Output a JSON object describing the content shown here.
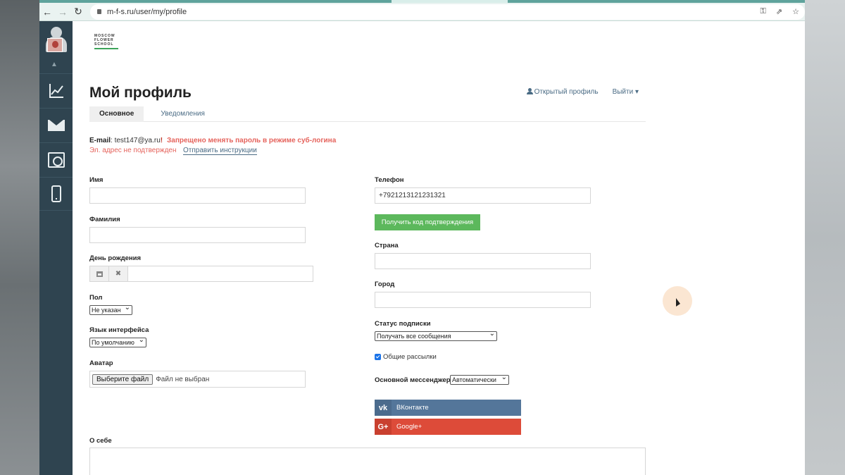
{
  "browser": {
    "url": "m-f-s.ru/user/my/profile"
  },
  "logo": {
    "line1": "MOSCOW",
    "line2": "FLOWER",
    "line3": "SCHOOL"
  },
  "page": {
    "title": "Мой профиль",
    "open_profile_link": "Открытый профиль",
    "logout_link": "Выйти ▾"
  },
  "tabs": [
    {
      "label": "Основное",
      "active": true
    },
    {
      "label": "Уведомления",
      "active": false
    }
  ],
  "email": {
    "label": "E-mail",
    "value": ": test147@ya.ru",
    "alert_mark": "!",
    "warning": "Запрещено менять пароль в режиме суб-логина",
    "unverified": "Эл. адрес не подтвержден",
    "send_instructions": "Отправить инструкции"
  },
  "form_left": {
    "name_label": "Имя",
    "name_value": "",
    "surname_label": "Фамилия",
    "surname_value": "",
    "birthday_label": "День рождения",
    "birthday_value": "",
    "gender_label": "Пол",
    "gender_value": "Не указан",
    "language_label": "Язык интерфейса",
    "language_value": "По умолчанию",
    "avatar_label": "Аватар",
    "avatar_button": "Выберите файл",
    "avatar_status": "Файл не выбран",
    "about_label": "О себе"
  },
  "form_right": {
    "phone_label": "Телефон",
    "phone_value": "+7921213121231321",
    "get_code_button": "Получить код подтверждения",
    "country_label": "Страна",
    "country_value": "",
    "city_label": "Город",
    "city_value": "",
    "subscription_label": "Статус подписки",
    "subscription_value": "Получать все сообщения",
    "newsletters_label": "Общие рассылки",
    "newsletters_checked": true,
    "messenger_label": "Основной мессенджер",
    "messenger_value": "Автоматически",
    "vk_button": "ВКонтакте",
    "vk_icon_text": "vk",
    "google_button": "Google+",
    "google_icon_text": "G+"
  },
  "colors": {
    "sidebar": "#2f4450",
    "link": "#4a6b84",
    "error": "#e5635c",
    "green_button": "#5cb85c",
    "vk": "#54769a",
    "google": "#dd4b39"
  }
}
